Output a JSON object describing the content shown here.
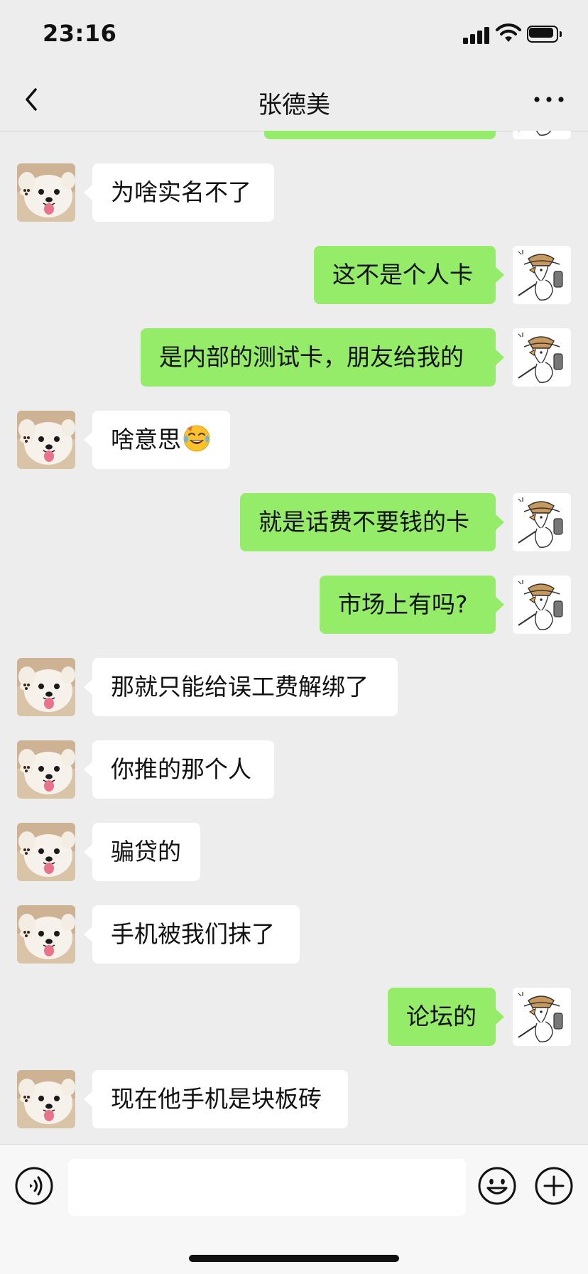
{
  "status_bar": {
    "time": "23:16"
  },
  "header": {
    "title": "张德美"
  },
  "messages": [
    {
      "side": "out",
      "text": ""
    },
    {
      "side": "in",
      "text": "为啥实名不了"
    },
    {
      "side": "out",
      "text": "这不是个人卡"
    },
    {
      "side": "out",
      "text": "是内部的测试卡，朋友给我的"
    },
    {
      "side": "in",
      "text": "啥意思",
      "emoji": "face-with-tears-of-joy-icon"
    },
    {
      "side": "out",
      "text": "就是话费不要钱的卡"
    },
    {
      "side": "out",
      "text": "市场上有吗?"
    },
    {
      "side": "in",
      "text": "那就只能给误工费解绑了"
    },
    {
      "side": "in",
      "text": "你推的那个人"
    },
    {
      "side": "in",
      "text": "骗贷的"
    },
    {
      "side": "in",
      "text": "手机被我们抹了"
    },
    {
      "side": "out",
      "text": "论坛的"
    },
    {
      "side": "in",
      "text": "现在他手机是块板砖"
    }
  ],
  "input_bar": {
    "text_value": "",
    "placeholder": ""
  },
  "colors": {
    "outgoing_bubble": "#95ec69",
    "incoming_bubble": "#ffffff",
    "background": "#ededed"
  }
}
